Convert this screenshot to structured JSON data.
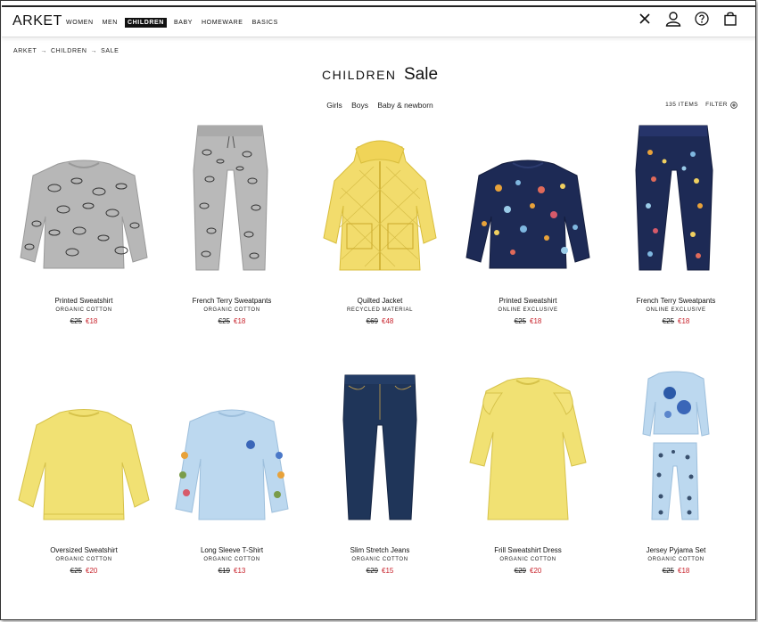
{
  "brand": "ARKET",
  "nav": [
    "WOMEN",
    "MEN",
    "CHILDREN",
    "BABY",
    "HOMEWARE",
    "BASICS"
  ],
  "nav_active": "CHILDREN",
  "header_icons": [
    "close-icon",
    "user-icon",
    "help-icon",
    "bag-icon"
  ],
  "breadcrumb": [
    "ARKET",
    "CHILDREN",
    "SALE"
  ],
  "breadcrumb_sep": "→",
  "page_title": {
    "category": "CHILDREN",
    "section": "Sale"
  },
  "subnav": [
    "Girls",
    "Boys",
    "Baby & newborn"
  ],
  "item_count": "135 ITEMS",
  "filter_label": "FILTER",
  "colors": {
    "sale_red": "#c8232c",
    "grey": "#b3b3b3",
    "yellow": "#f0dc6b",
    "navy": "#1d2a55",
    "light_blue": "#bcd8ef",
    "denim": "#1f3559"
  },
  "products": [
    {
      "name": "Printed Sweatshirt",
      "tag": "ORGANIC COTTON",
      "old_price": "€25",
      "new_price": "€18"
    },
    {
      "name": "French Terry Sweatpants",
      "tag": "ORGANIC COTTON",
      "old_price": "€25",
      "new_price": "€18"
    },
    {
      "name": "Quilted Jacket",
      "tag": "RECYCLED MATERIAL",
      "old_price": "€69",
      "new_price": "€48"
    },
    {
      "name": "Printed Sweatshirt",
      "tag": "ONLINE EXCLUSIVE",
      "old_price": "€25",
      "new_price": "€18"
    },
    {
      "name": "French Terry Sweatpants",
      "tag": "ONLINE EXCLUSIVE",
      "old_price": "€25",
      "new_price": "€18"
    },
    {
      "name": "Oversized Sweatshirt",
      "tag": "ORGANIC COTTON",
      "old_price": "€25",
      "new_price": "€20"
    },
    {
      "name": "Long Sleeve T-Shirt",
      "tag": "ORGANIC COTTON",
      "old_price": "€19",
      "new_price": "€13"
    },
    {
      "name": "Slim Stretch Jeans",
      "tag": "ORGANIC COTTON",
      "old_price": "€29",
      "new_price": "€15"
    },
    {
      "name": "Frill Sweatshirt Dress",
      "tag": "ORGANIC COTTON",
      "old_price": "€29",
      "new_price": "€20"
    },
    {
      "name": "Jersey Pyjama Set",
      "tag": "ORGANIC COTTON",
      "old_price": "€25",
      "new_price": "€18"
    }
  ]
}
